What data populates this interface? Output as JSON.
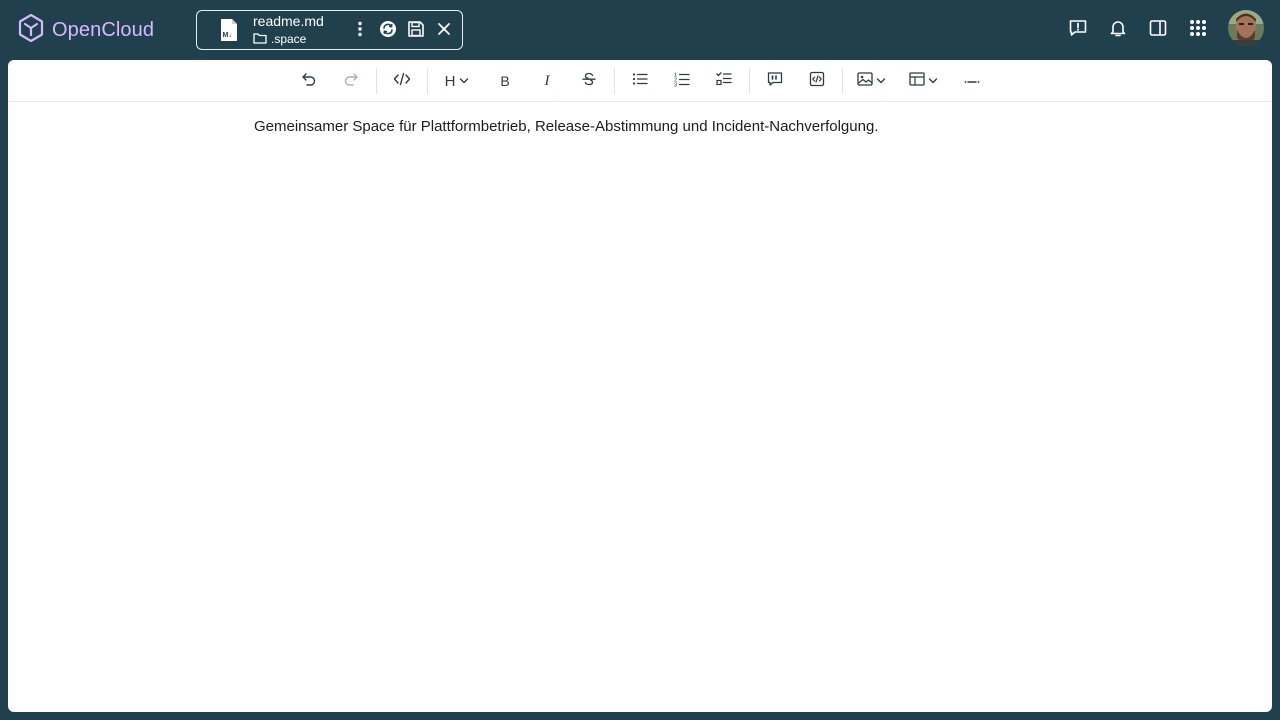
{
  "app": {
    "name": "OpenCloud",
    "logo_color": "#d7b8ff",
    "background": "#20404d"
  },
  "file_tab": {
    "file_name": "readme.md",
    "folder_name": ".space",
    "file_icon": "markdown-file-icon",
    "actions": [
      "more-options-icon",
      "sync-icon",
      "save-icon",
      "close-icon"
    ]
  },
  "header_actions": [
    "feedback-icon",
    "notifications-icon",
    "sidebar-toggle-icon",
    "app-switcher-icon",
    "avatar"
  ],
  "toolbar": {
    "items": [
      "undo-icon",
      "redo-icon",
      "code-icon",
      "heading-icon",
      "bold-icon",
      "italic-icon",
      "strikethrough-icon",
      "bullet-list-icon",
      "ordered-list-icon",
      "task-list-icon",
      "quote-icon",
      "code-block-icon",
      "image-icon",
      "table-icon",
      "horizontal-rule-icon"
    ],
    "heading_label": "H",
    "bold_label": "B",
    "italic_label": "I"
  },
  "document": {
    "paragraph": "Gemeinsamer Space für Plattformbetrieb, Release-Abstimmung und Incident-Nachverfolgung."
  }
}
